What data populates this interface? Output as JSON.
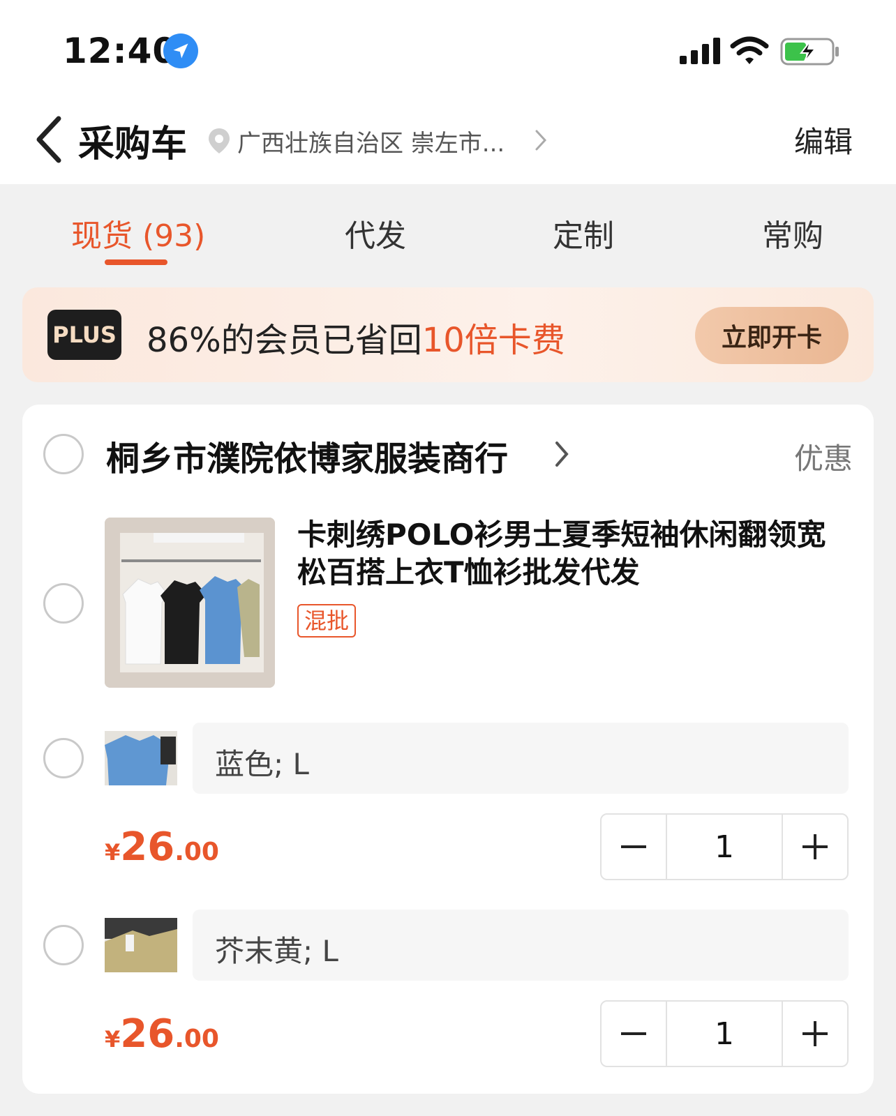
{
  "status_bar": {
    "time": "12:40",
    "icons": [
      "location-arrow-icon",
      "signal-icon",
      "wifi-icon",
      "battery-charging-icon"
    ]
  },
  "nav": {
    "title": "采购车",
    "address": "广西壮族自治区 崇左市...",
    "edit_label": "编辑"
  },
  "tabs": [
    {
      "label": "现货 (93)",
      "active": true
    },
    {
      "label": "代发",
      "active": false
    },
    {
      "label": "定制",
      "active": false
    },
    {
      "label": "常购",
      "active": false
    }
  ],
  "plus_banner": {
    "badge": "PLUS",
    "text": "86%的会员已省回",
    "highlight": "10倍卡费",
    "button": "立即开卡"
  },
  "shop": {
    "name": "桐乡市濮院依博家服装商行",
    "discount_label": "优惠",
    "product": {
      "title": "卡刺绣POLO衫男士夏季短袖休闲翻领宽松百搭上衣T恤衫批发代发",
      "tag": "混批",
      "skus": [
        {
          "spec": "蓝色; L",
          "currency": "¥",
          "price_int": "26",
          "price_dec": ".00",
          "quantity": "1"
        },
        {
          "spec": "芥末黄; L",
          "currency": "¥",
          "price_int": "26",
          "price_dec": ".00",
          "quantity": "1"
        }
      ]
    }
  },
  "colors": {
    "accent": "#e8562b",
    "plus_badge_bg": "#1e1e1e",
    "page_bg": "#f1f1f1"
  }
}
